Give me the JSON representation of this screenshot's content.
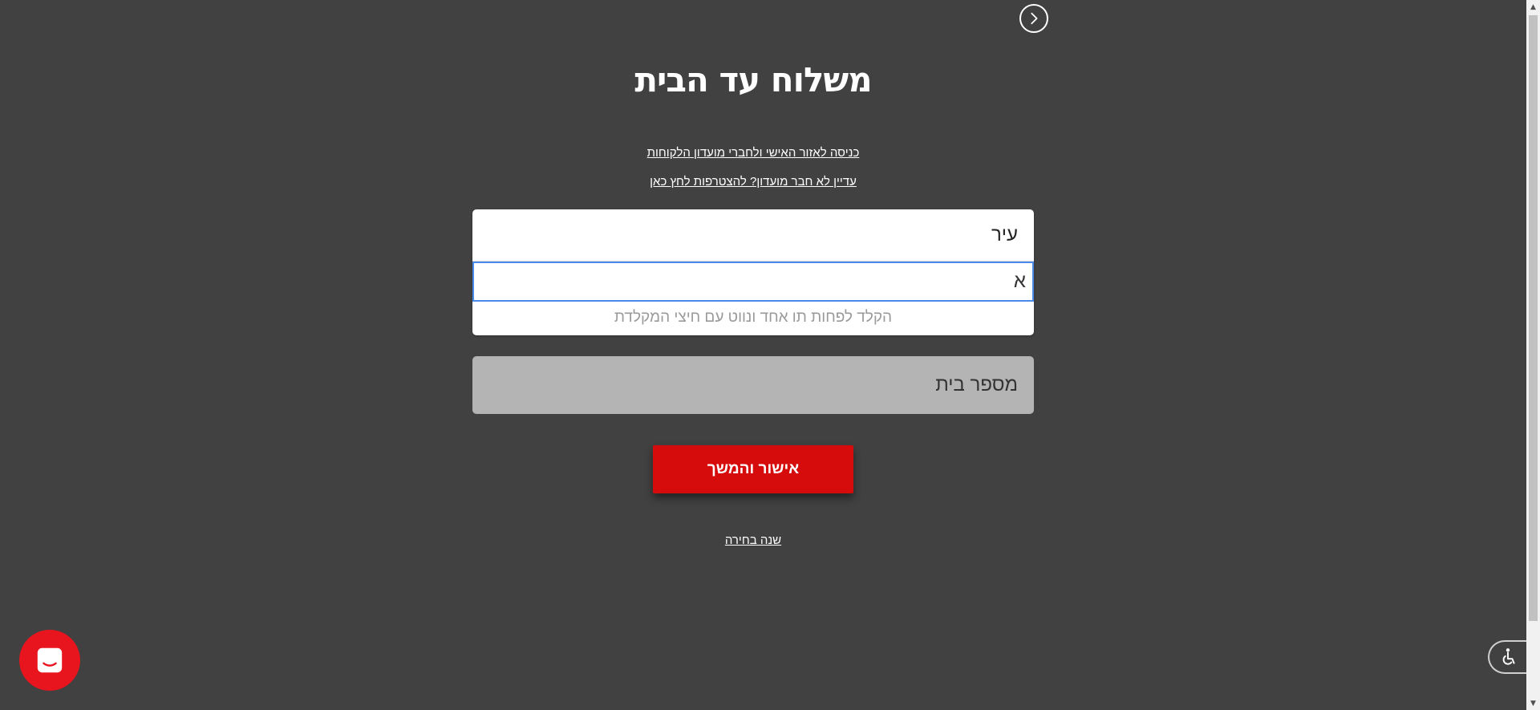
{
  "header": {
    "back_icon": "chevron-right-icon",
    "title": "משלוח עד הבית"
  },
  "links": {
    "login": "כניסה לאזור האישי ולחברי מועדון הלקוחות",
    "join": "עדיין לא חבר מועדון? להצטרפות לחץ כאן",
    "change_selection": "שנה בחירה"
  },
  "form": {
    "city_label": "עיר",
    "city_value": "א",
    "city_hint": "הקלד לפחות תו אחד ונווט עם חיצי המקלדת",
    "house_number_placeholder": "מספר בית",
    "confirm_label": "אישור והמשך"
  },
  "widgets": {
    "chat_icon": "chat-icon",
    "accessibility_icon": "wheelchair-icon"
  },
  "colors": {
    "background": "#414141",
    "accent": "#d60b0b",
    "input_focus": "#4a8ae8",
    "disabled_field": "#b4b4b4"
  }
}
